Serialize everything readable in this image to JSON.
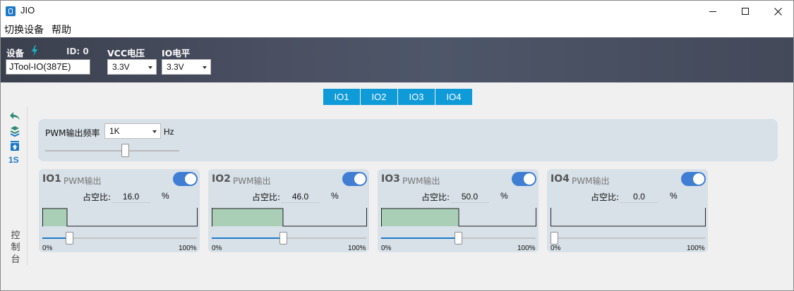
{
  "window": {
    "title": "JIO"
  },
  "menu": {
    "items": [
      "切换设备",
      "帮助"
    ]
  },
  "device": {
    "device_label": "设备",
    "id_label": "ID: 0",
    "device_value": "JTool-IO(387E)",
    "vcc_label": "VCC电压",
    "vcc_value": "3.3V",
    "io_label": "IO电平",
    "io_value": "3.3V"
  },
  "tabs": [
    "IO1",
    "IO2",
    "IO3",
    "IO4"
  ],
  "sidebar": {
    "timer_label": "1S",
    "console_chars": [
      "控",
      "制",
      "台"
    ]
  },
  "pwm": {
    "freq_label": "PWM输出频率",
    "freq_value": "1K",
    "freq_unit": "Hz"
  },
  "channels": [
    {
      "name": "IO1",
      "mode": "PWM输出",
      "duty_label": "占空比:",
      "duty_value": "16.0",
      "unit": "%",
      "duty": 16.0,
      "enabled": true,
      "min_label": "0%",
      "max_label": "100%"
    },
    {
      "name": "IO2",
      "mode": "PWM输出",
      "duty_label": "占空比:",
      "duty_value": "46.0",
      "unit": "%",
      "duty": 46.0,
      "enabled": true,
      "min_label": "0%",
      "max_label": "100%"
    },
    {
      "name": "IO3",
      "mode": "PWM输出",
      "duty_label": "占空比:",
      "duty_value": "50.0",
      "unit": "%",
      "duty": 50.0,
      "enabled": true,
      "min_label": "0%",
      "max_label": "100%"
    },
    {
      "name": "IO4",
      "mode": "PWM输出",
      "duty_label": "占空比:",
      "duty_value": "0.0",
      "unit": "%",
      "duty": 0.0,
      "enabled": true,
      "min_label": "0%",
      "max_label": "100%"
    }
  ],
  "colors": {
    "accent": "#0f9ad8",
    "toggle_on": "#3f7ed3",
    "wave_fill": "#a9cfb7",
    "slider_fill": "#1b79c7",
    "sidebar_icon": "#2e8b73"
  },
  "icons": [
    "undo-icon",
    "layers-icon",
    "upload-icon"
  ]
}
